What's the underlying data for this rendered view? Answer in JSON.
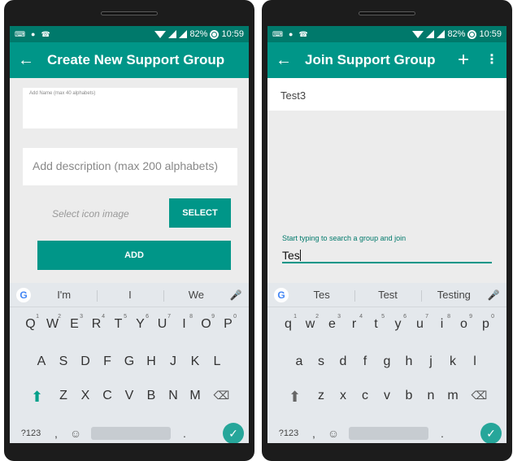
{
  "left": {
    "status": {
      "battery": "82%",
      "time": "10:59"
    },
    "appbar": {
      "title": "Create New Support Group"
    },
    "form": {
      "name_hint": "Add Name (max 40 alphabets)",
      "name_value": "",
      "description_placeholder": "Add description (max 200 alphabets)",
      "icon_label": "Select icon image",
      "select_label": "SELECT",
      "add_label": "ADD"
    },
    "keyboard": {
      "suggestions": [
        "I'm",
        "I",
        "We"
      ],
      "row1": [
        {
          "key": "Q",
          "sup": "1"
        },
        {
          "key": "W",
          "sup": "2"
        },
        {
          "key": "E",
          "sup": "3"
        },
        {
          "key": "R",
          "sup": "4"
        },
        {
          "key": "T",
          "sup": "5"
        },
        {
          "key": "Y",
          "sup": "6"
        },
        {
          "key": "U",
          "sup": "7"
        },
        {
          "key": "I",
          "sup": "8"
        },
        {
          "key": "O",
          "sup": "9"
        },
        {
          "key": "P",
          "sup": "0"
        }
      ],
      "row2": [
        "A",
        "S",
        "D",
        "F",
        "G",
        "H",
        "J",
        "K",
        "L"
      ],
      "row3": [
        "Z",
        "X",
        "C",
        "V",
        "B",
        "N",
        "M"
      ],
      "sym_label": "?123",
      "comma": ",",
      "period": "."
    }
  },
  "right": {
    "status": {
      "battery": "82%",
      "time": "10:59"
    },
    "appbar": {
      "title": "Join Support Group"
    },
    "list": [
      {
        "name": "Test3"
      }
    ],
    "search": {
      "hint": "Start typing to search a group and join",
      "value": "Tes"
    },
    "keyboard": {
      "suggestions": [
        "Tes",
        "Test",
        "Testing"
      ],
      "row1": [
        {
          "key": "q",
          "sup": "1"
        },
        {
          "key": "w",
          "sup": "2"
        },
        {
          "key": "e",
          "sup": "3"
        },
        {
          "key": "r",
          "sup": "4"
        },
        {
          "key": "t",
          "sup": "5"
        },
        {
          "key": "y",
          "sup": "6"
        },
        {
          "key": "u",
          "sup": "7"
        },
        {
          "key": "i",
          "sup": "8"
        },
        {
          "key": "o",
          "sup": "9"
        },
        {
          "key": "p",
          "sup": "0"
        }
      ],
      "row2": [
        "a",
        "s",
        "d",
        "f",
        "g",
        "h",
        "j",
        "k",
        "l"
      ],
      "row3": [
        "z",
        "x",
        "c",
        "v",
        "b",
        "n",
        "m"
      ],
      "sym_label": "?123",
      "comma": ",",
      "period": "."
    }
  },
  "colors": {
    "primary": "#009688",
    "primary_dark": "#00796b",
    "accent_enter": "#26a69a"
  }
}
